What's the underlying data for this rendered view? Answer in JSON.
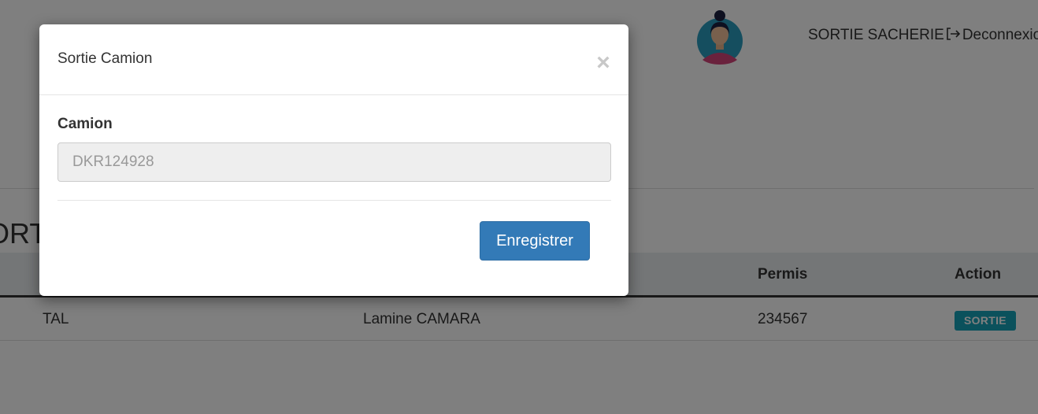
{
  "header": {
    "user_text": "SORTIE SACHERIE",
    "logout_label": "Deconnexion"
  },
  "page": {
    "heading": "SORTIE SACHERIE"
  },
  "table": {
    "columns": [
      "Permis",
      "Action"
    ],
    "rows": [
      {
        "col1": "TAL",
        "col2": "Lamine CAMARA",
        "permis": "234567",
        "action": "SORTIE"
      }
    ]
  },
  "modal": {
    "title": "Sortie Camion",
    "close_symbol": "×",
    "field_label": "Camion",
    "field_placeholder": "DKR124928",
    "save_label": "Enregistrer"
  },
  "colors": {
    "primary_button": "#337ab7",
    "badge": "#17a2b8",
    "backdrop": "rgba(0,0,0,0.5)"
  },
  "icons": [
    "avatar",
    "logout-icon",
    "close-icon"
  ]
}
